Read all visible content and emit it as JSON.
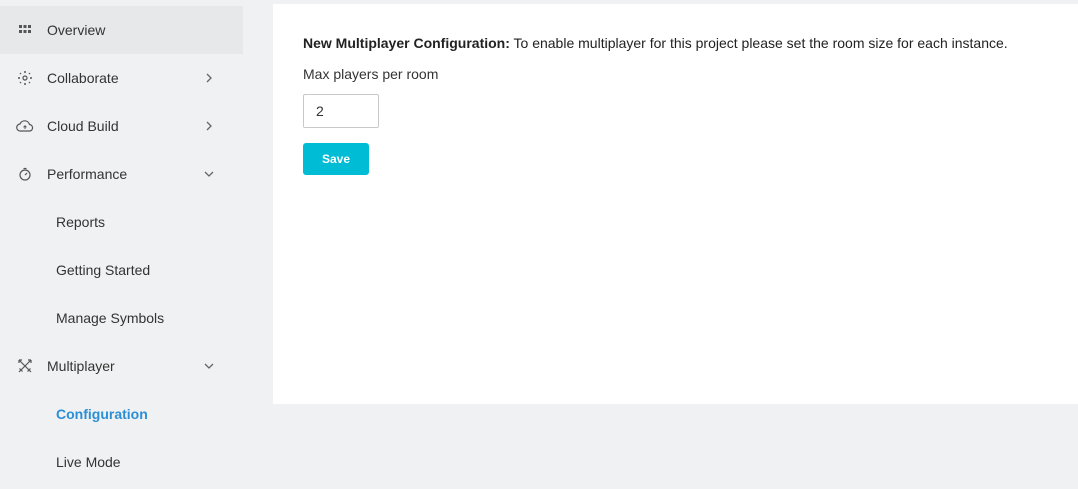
{
  "sidebar": {
    "items": [
      {
        "label": "Overview",
        "icon": "grid-icon"
      },
      {
        "label": "Collaborate",
        "icon": "collaborate-icon",
        "chevron": "chevron-right-icon"
      },
      {
        "label": "Cloud Build",
        "icon": "cloud-icon",
        "chevron": "chevron-right-icon"
      },
      {
        "label": "Performance",
        "icon": "stopwatch-icon",
        "chevron": "chevron-down-icon"
      },
      {
        "label": "Reports"
      },
      {
        "label": "Getting Started"
      },
      {
        "label": "Manage Symbols"
      },
      {
        "label": "Multiplayer",
        "icon": "crossed-swords-icon",
        "chevron": "chevron-down-icon"
      },
      {
        "label": "Configuration"
      },
      {
        "label": "Live Mode"
      }
    ]
  },
  "main": {
    "notice_title": "New Multiplayer Configuration:",
    "notice_text": " To enable multiplayer for this project please set the room size for each instance.",
    "field_label": "Max players per room",
    "room_size_value": "2",
    "save_label": "Save"
  },
  "colors": {
    "accent": "#00bcd4",
    "active_link": "#2b8fd6",
    "sidebar_bg": "#f0f1f2",
    "content_bg": "#ffffff"
  }
}
